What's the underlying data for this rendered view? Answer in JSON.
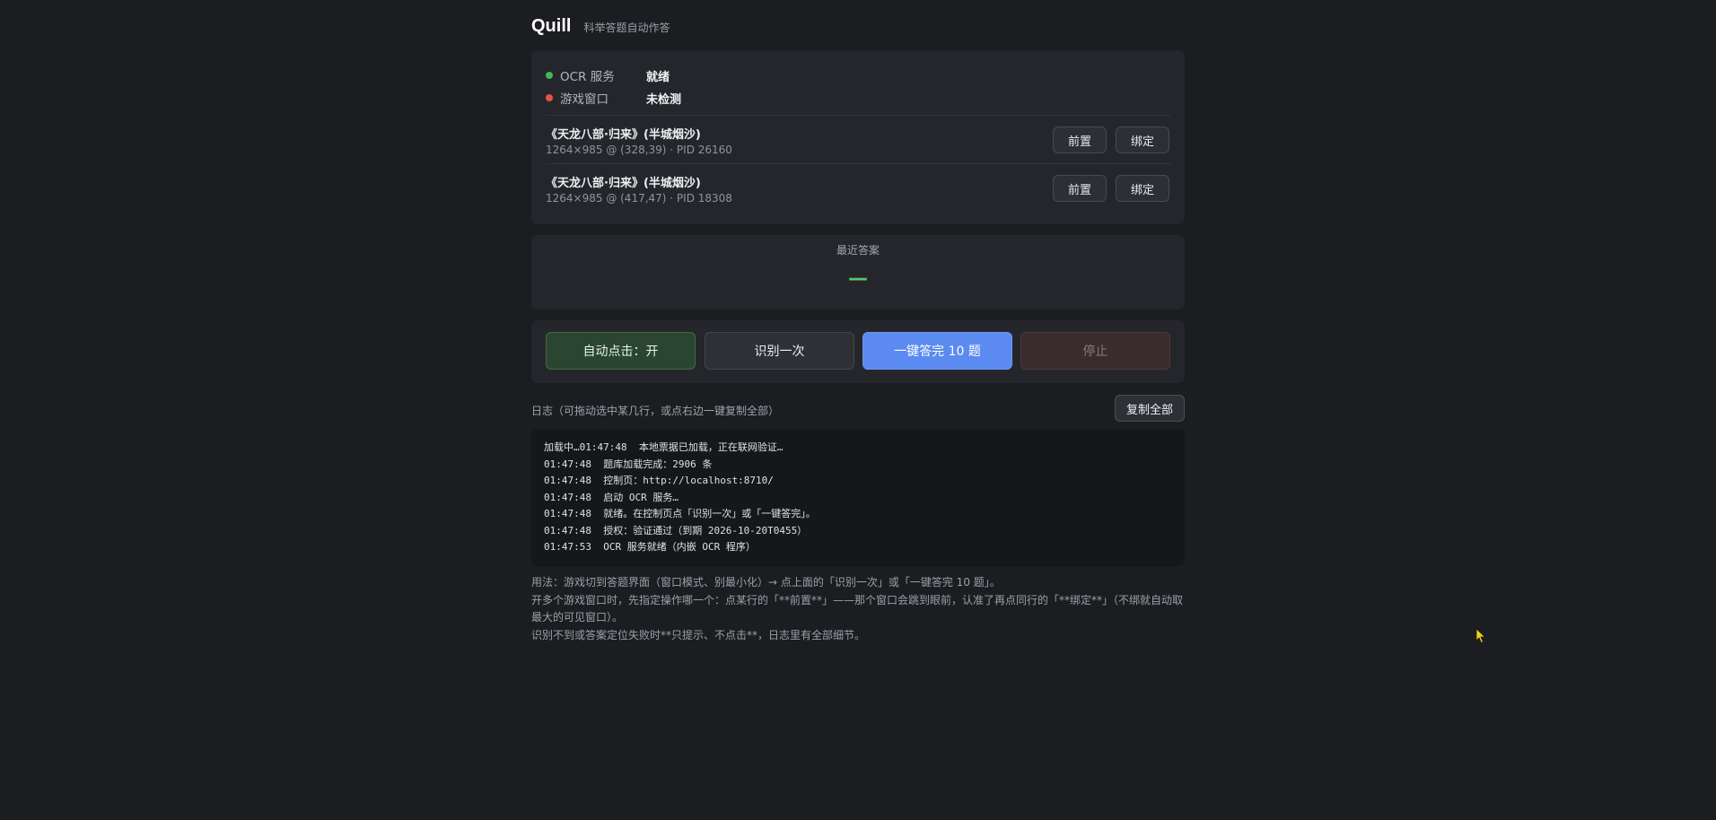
{
  "header": {
    "title": "Quill",
    "subtitle": "科举答题自动作答"
  },
  "status": {
    "ocr": {
      "label": "OCR 服务",
      "value": "就绪",
      "color": "#3fb950"
    },
    "game": {
      "label": "游戏窗口",
      "value": "未检测",
      "color": "#e5534b"
    }
  },
  "windows": [
    {
      "name": "《天龙八部·归来》(半城烟沙)",
      "meta": "1264×985 @ (328,39) · PID 26160",
      "front_label": "前置",
      "bind_label": "绑定"
    },
    {
      "name": "《天龙八部·归来》(半城烟沙)",
      "meta": "1264×985 @ (417,47) · PID 18308",
      "front_label": "前置",
      "bind_label": "绑定"
    }
  ],
  "answer": {
    "label": "最近答案",
    "value": "—"
  },
  "actions": {
    "auto_click": "自动点击：开",
    "recognize_once": "识别一次",
    "answer_all": "一键答完 10 题",
    "stop": "停止"
  },
  "log": {
    "title": "日志（可拖动选中某几行，或点右边一键复制全部）",
    "copy_all": "复制全部",
    "lines": [
      "加载中…01:47:48  本地票据已加载，正在联网验证…",
      "01:47:48  题库加载完成：2906 条",
      "01:47:48  控制页：http://localhost:8710/",
      "01:47:48  启动 OCR 服务…",
      "01:47:48  就绪。在控制页点「识别一次」或「一键答完」。",
      "01:47:48  授权：验证通过（到期 2026-10-20T0455）",
      "01:47:53  OCR 服务就绪（内嵌 OCR 程序）"
    ]
  },
  "help": {
    "line1": "用法：游戏切到答题界面（窗口模式、别最小化）→ 点上面的「识别一次」或「一键答完 10 题」。",
    "line2": "开多个游戏窗口时，先指定操作哪一个：点某行的「**前置**」——那个窗口会跳到眼前，认准了再点同行的「**绑定**」（不绑就自动取最大的可见窗口）。",
    "line3": "识别不到或答案定位失败时**只提示、不点击**，日志里有全部细节。"
  },
  "colors": {
    "background": "#1c1d21",
    "card": "#25262b",
    "accent_blue": "#5b8bf0",
    "auto_green": "#2b4630",
    "answer_green": "#58c76e"
  }
}
